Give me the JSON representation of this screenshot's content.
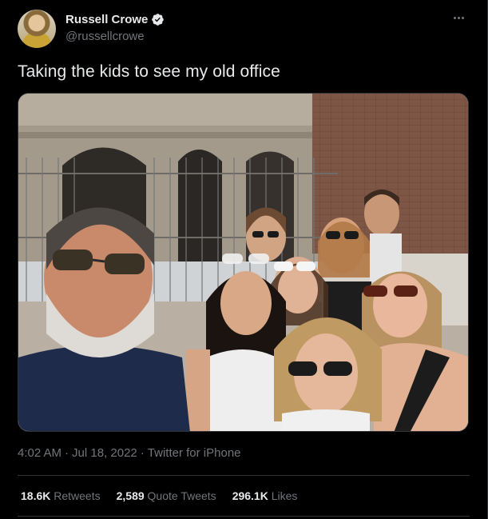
{
  "author": {
    "display_name": "Russell Crowe",
    "handle": "@russellcrowe",
    "verified": true,
    "verified_color": "#e7e9ea"
  },
  "tweet": {
    "text": "Taking the kids to see my old office"
  },
  "meta": {
    "time": "4:02 AM",
    "separator": "·",
    "date": "Jul 18, 2022",
    "source": "Twitter for iPhone"
  },
  "stats": {
    "retweets_count": "18.6K",
    "retweets_label": "Retweets",
    "quote_count": "2,589",
    "quote_label": "Quote Tweets",
    "likes_count": "296.1K",
    "likes_label": "Likes"
  },
  "icons": {
    "more": "more-horizontal-icon",
    "verified": "verified-badge-icon"
  },
  "colors": {
    "background": "#000000",
    "text_primary": "#e7e9ea",
    "text_secondary": "#71767b",
    "divider": "#2f3336"
  }
}
